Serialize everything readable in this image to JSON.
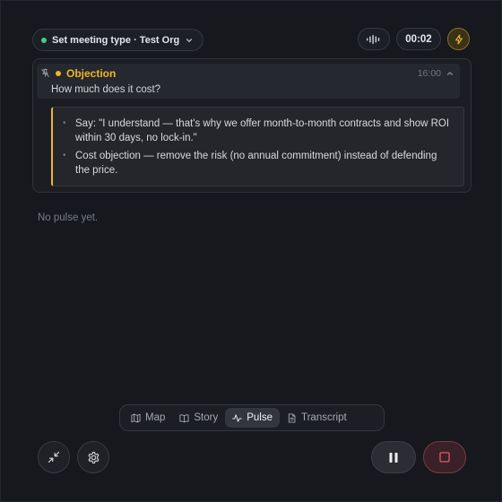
{
  "header": {
    "meeting_label": "Set meeting type · Test Org",
    "timer": "00:02",
    "status_color": "#3ecf8e",
    "accent_color": "#f0b429"
  },
  "card": {
    "type_label": "Objection",
    "time": "16:00",
    "question": "How much does it cost?",
    "tips": [
      "Say: \"I understand — that's why we offer month-to-month contracts and show ROI within 30 days, no lock-in.\"",
      "Cost objection — remove the risk (no annual commitment) instead of defending the price."
    ]
  },
  "pulse": {
    "empty_text": "No pulse yet."
  },
  "tabs": [
    {
      "label": "Map",
      "icon": "map-icon"
    },
    {
      "label": "Story",
      "icon": "book-icon"
    },
    {
      "label": "Pulse",
      "icon": "pulse-icon",
      "active": true
    },
    {
      "label": "Transcript",
      "icon": "document-icon"
    }
  ],
  "controls": {
    "minimize_icon": "minimize-icon",
    "settings_icon": "gear-icon",
    "pause_icon": "pause-icon",
    "stop_icon": "stop-icon",
    "stop_color": "#e05a6a"
  }
}
